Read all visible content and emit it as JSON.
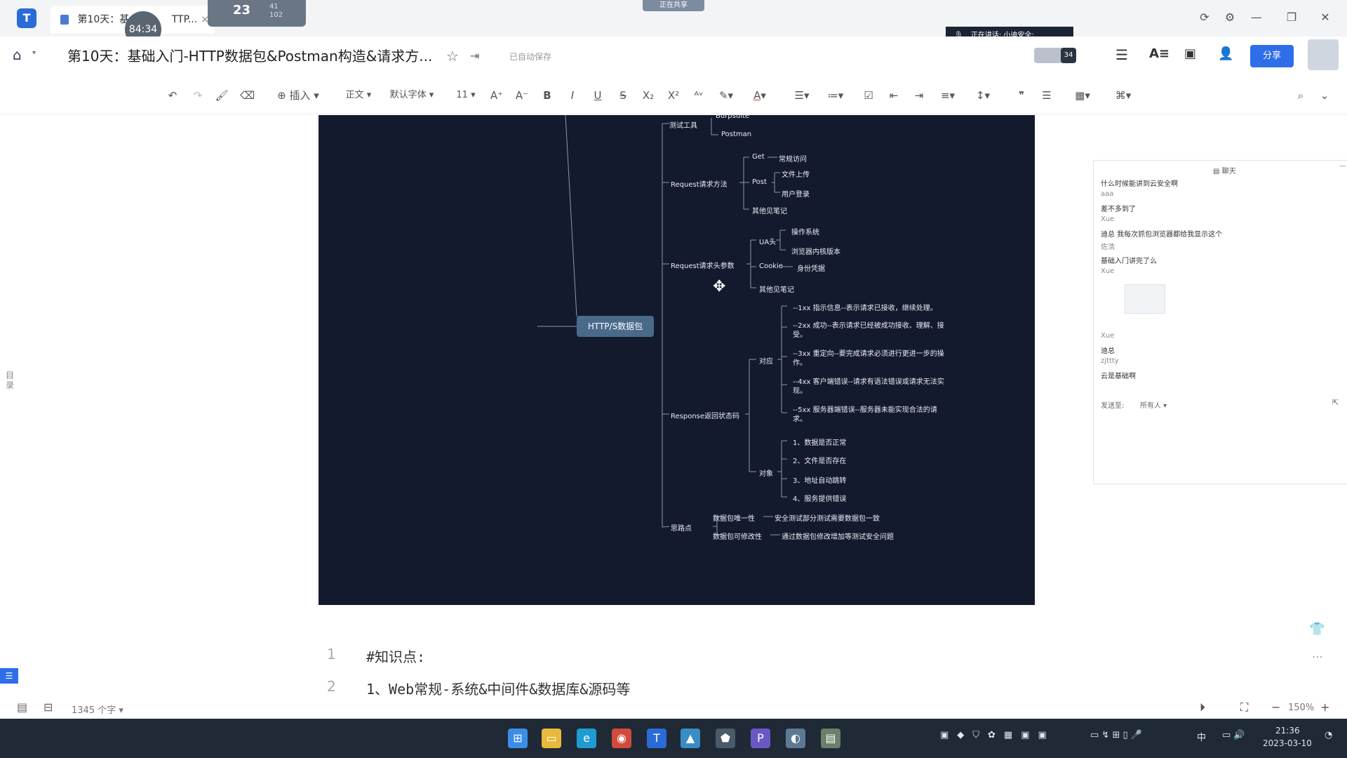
{
  "titlebar": {
    "tab_active_label": "第10天：基",
    "tab_second_label": "TTP...",
    "timer_badge": "84:34",
    "overlay_counter": "23",
    "overlay_sub": "41\n102",
    "top_center_label": "正在共享"
  },
  "header": {
    "doc_title": "第10天：基础入门-HTTP数据包&Postman构造&请求方...",
    "autosave": "已自动保存",
    "speaking": "正在讲话: 小迪安全;",
    "participant_count": "34",
    "share_label": "分享"
  },
  "toolbar": {
    "insert_label": "插入",
    "style_label": "正文",
    "font_label": "默认字体",
    "size_label": "11"
  },
  "mindmap": {
    "root": "HTTP/S数据包",
    "test_tools": "测试工具",
    "burpsuite": "Burpsuite",
    "postman": "Postman",
    "request_method": "Request请求方法",
    "get": "Get",
    "get_desc": "常规访问",
    "post": "Post",
    "post_upload": "文件上传",
    "post_login": "用户登录",
    "other_notes_1": "其他见笔记",
    "request_header": "Request请求头参数",
    "ua": "UA头",
    "ua_os": "操作系统",
    "ua_browser": "浏览器内核版本",
    "cookie": "Cookie",
    "cookie_desc": "身份凭据",
    "other_notes_2": "其他见笔记",
    "response_code": "Response返回状态码",
    "correspond": "对应",
    "c1": "--1xx 指示信息--表示请求已接收，继续处理。",
    "c2": "--2xx 成功--表示请求已经被成功接收、理解、接受。",
    "c3": "--3xx 重定向--要完成请求必须进行更进一步的操作。",
    "c4": "--4xx 客户端错误--请求有语法错误或请求无法实现。",
    "c5": "--5xx 服务器端错误--服务器未能实现合法的请求。",
    "object": "对象",
    "o1": "1、数据是否正常",
    "o2": "2、文件是否存在",
    "o3": "3、地址自动跳转",
    "o4": "4、服务提供错误",
    "thinking": "思路点",
    "t1": "数据包唯一性",
    "t1_desc": "安全测试部分测试需要数据包一致",
    "t2": "数据包可修改性",
    "t2_desc": "通过数据包修改增加等测试安全问题"
  },
  "chat": {
    "title": "聊天",
    "messages": [
      {
        "text": "什么时候能讲到云安全啊"
      },
      {
        "user": "aaa"
      },
      {
        "text": "差不多到了"
      },
      {
        "user": "Xue"
      },
      {
        "text": "迪总 我每次抓包浏览器都给我显示这个"
      },
      {
        "user": "佐浩"
      },
      {
        "text": "基础入门讲完了么"
      },
      {
        "user": "Xue"
      },
      {
        "user": "Xue"
      },
      {
        "text": "迪总"
      },
      {
        "user": "zjttty"
      },
      {
        "text": "云是基础啊"
      }
    ],
    "send_to_label": "发送至:",
    "send_to_value": "所有人"
  },
  "sidebar_left": {
    "toc_label": "目录"
  },
  "editor": {
    "lines": [
      {
        "no": "1",
        "text": "#知识点:"
      },
      {
        "no": "2",
        "text": "1、Web常规-系统&中间件&数据库&源码等"
      }
    ]
  },
  "statusbar": {
    "word_count": "1345 个字",
    "zoom": "150%"
  },
  "taskbar": {
    "time": "21:36",
    "date": "2023-03-10",
    "ime": "中"
  }
}
